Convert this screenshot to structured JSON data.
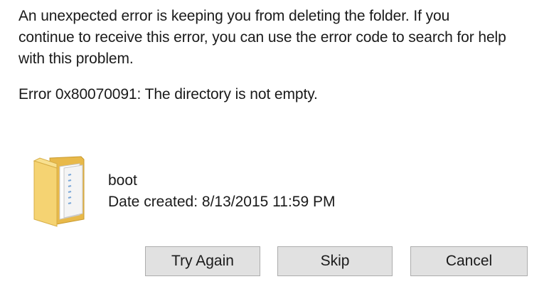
{
  "dialog": {
    "message_line1": "An unexpected error is keeping you from deleting the folder. If you",
    "message_line2": "continue to receive this error, you can use the error code to search for help",
    "message_line3": "with this problem.",
    "error_text": "Error 0x80070091: The directory is not empty."
  },
  "file": {
    "icon": "folder-icon",
    "name": "boot",
    "date_created": "Date created: 8/13/2015 11:59 PM"
  },
  "buttons": {
    "try_again": "Try Again",
    "skip": "Skip",
    "cancel": "Cancel"
  },
  "colors": {
    "button_bg": "#e1e1e1",
    "button_border": "#adadad",
    "folder_yellow": "#f5d372"
  }
}
